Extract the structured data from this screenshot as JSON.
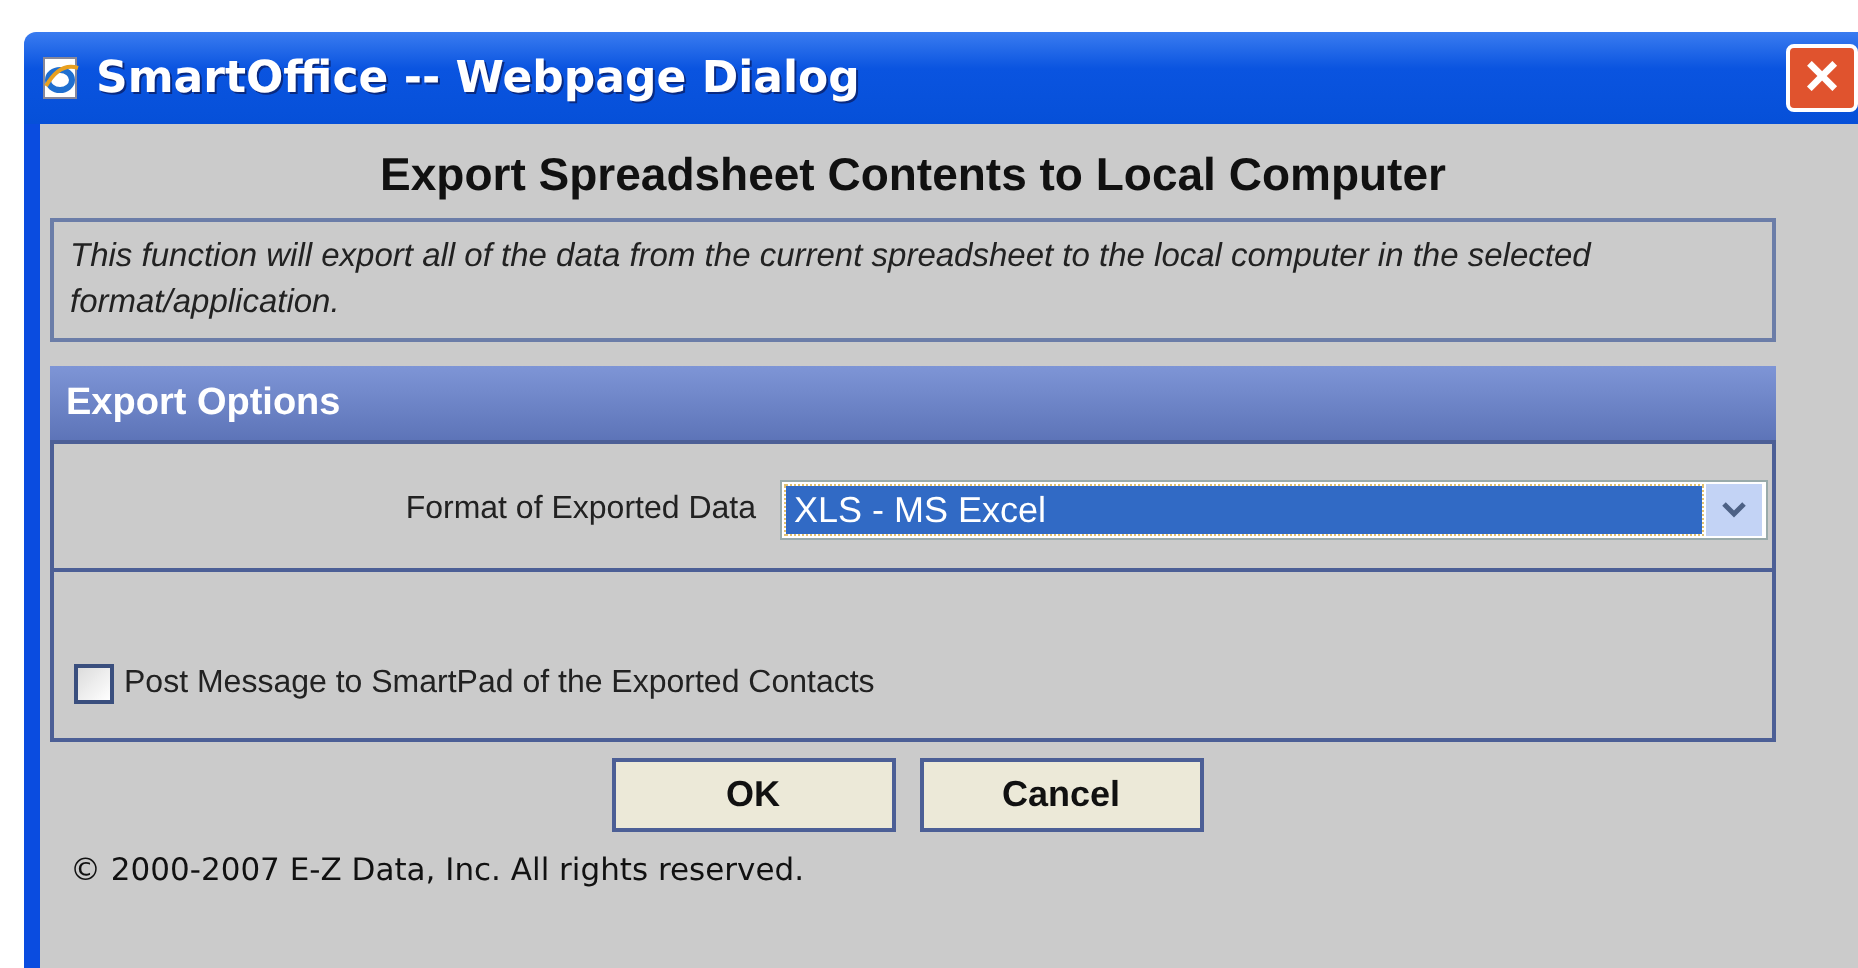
{
  "window": {
    "title": "SmartOffice -- Webpage Dialog",
    "close": "×"
  },
  "heading": "Export Spreadsheet Contents to Local Computer",
  "description": "This function will export all of the data from the current spreadsheet to the local computer in the selected format/application.",
  "section": {
    "title": "Export Options"
  },
  "format": {
    "label": "Format of Exported Data",
    "value": "XLS - MS Excel"
  },
  "post_message": {
    "label": "Post Message to SmartPad of the Exported Contacts",
    "checked": false
  },
  "buttons": [
    "OK",
    "Cancel"
  ],
  "copyright": "© 2000-2007 E-Z Data, Inc. All rights reserved."
}
